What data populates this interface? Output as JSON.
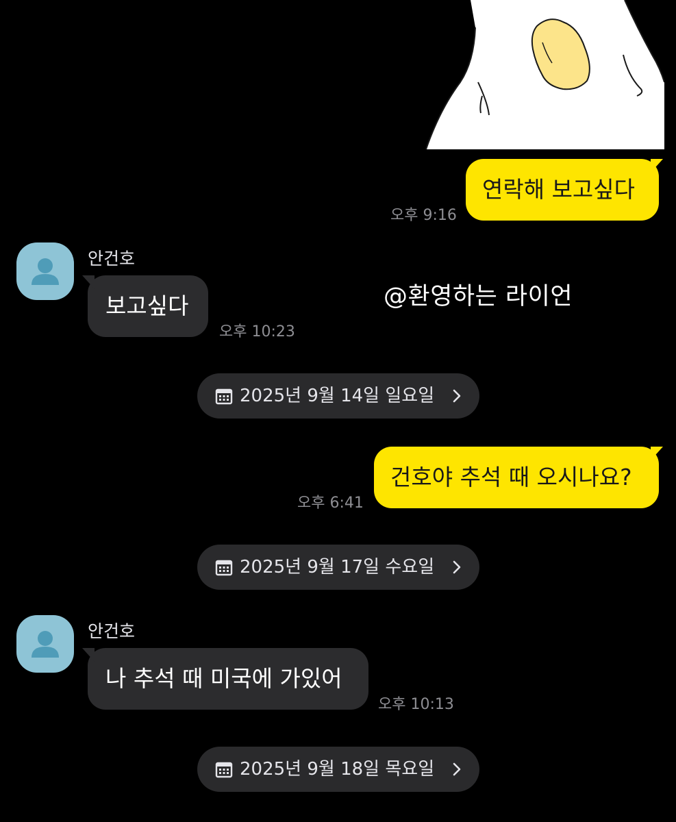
{
  "watermark": "@환영하는 라이언",
  "messages": [
    {
      "type": "out",
      "text": "연락해 보고싶다",
      "time": "오후 9:16"
    },
    {
      "type": "in",
      "sender": "안건호",
      "text": "보고싶다",
      "time": "오후 10:23"
    },
    {
      "type": "date",
      "text": "2025년 9월 14일 일요일"
    },
    {
      "type": "out",
      "text": "건호야 추석 때 오시나요?",
      "time": "오후 6:41"
    },
    {
      "type": "date",
      "text": "2025년 9월 17일 수요일"
    },
    {
      "type": "in",
      "sender": "안건호",
      "text": "나 추석 때 미국에 가있어",
      "time": "오후 10:13"
    },
    {
      "type": "date",
      "text": "2025년 9월 18일 목요일"
    }
  ],
  "icons": {
    "avatar": "person-icon",
    "date": "calendar-icon",
    "chevron": "chevron-right-icon"
  },
  "colors": {
    "background": "#000000",
    "outgoing_bubble": "#FEE500",
    "incoming_bubble": "#2C2C2E",
    "avatar_bg": "#8EC4D6",
    "time_text": "#8E8E93"
  }
}
